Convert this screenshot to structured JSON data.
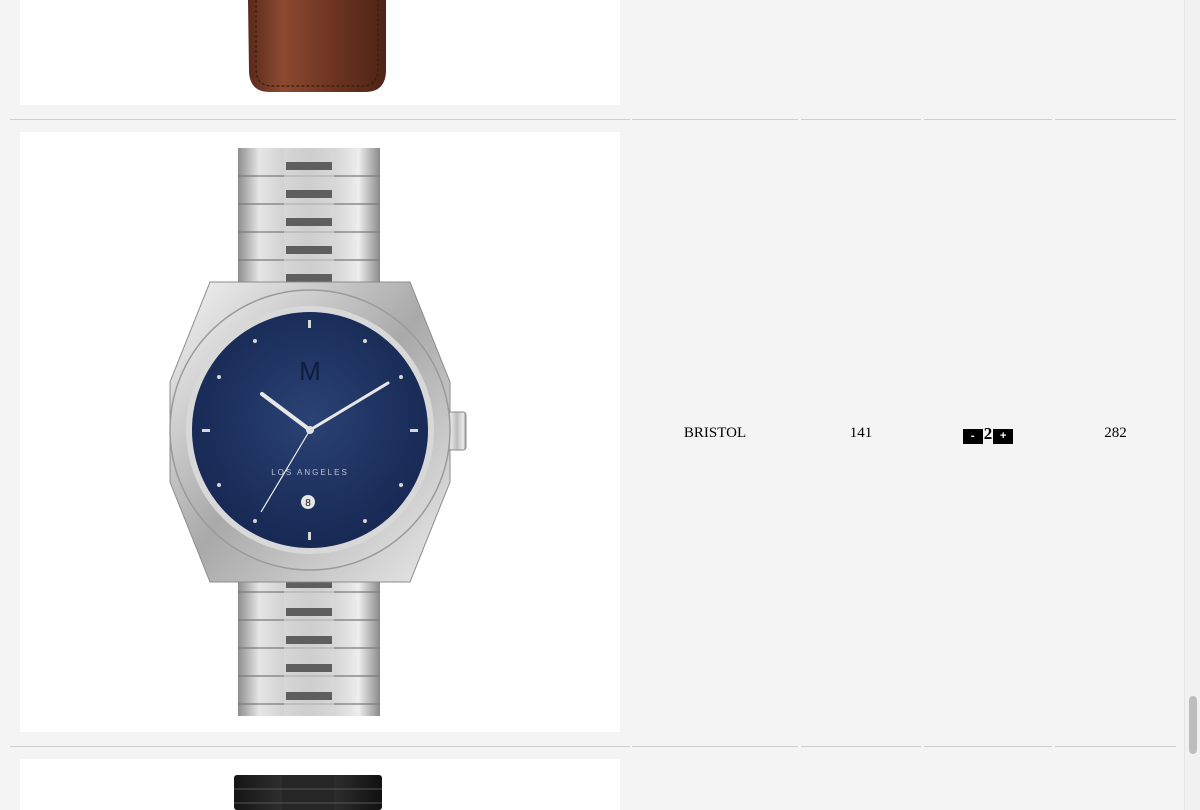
{
  "product_row": {
    "name": "BRISTOL",
    "price": "141",
    "quantity": "2",
    "minus_label": "-",
    "plus_label": "+",
    "total": "282"
  },
  "images": {
    "top": "brown-leather-strap-watch",
    "middle": "silver-bracelet-blue-dial-watch",
    "bottom": "black-bracelet-watch"
  },
  "watch_face": {
    "dial_text": "LOS ANGELES",
    "date_window": "8",
    "logo": "M"
  },
  "colors": {
    "page_bg": "#f4f4f4",
    "dial_blue": "#1d2f5a",
    "strap_brown": "#6b3422",
    "steel": "#c9c9c9"
  }
}
